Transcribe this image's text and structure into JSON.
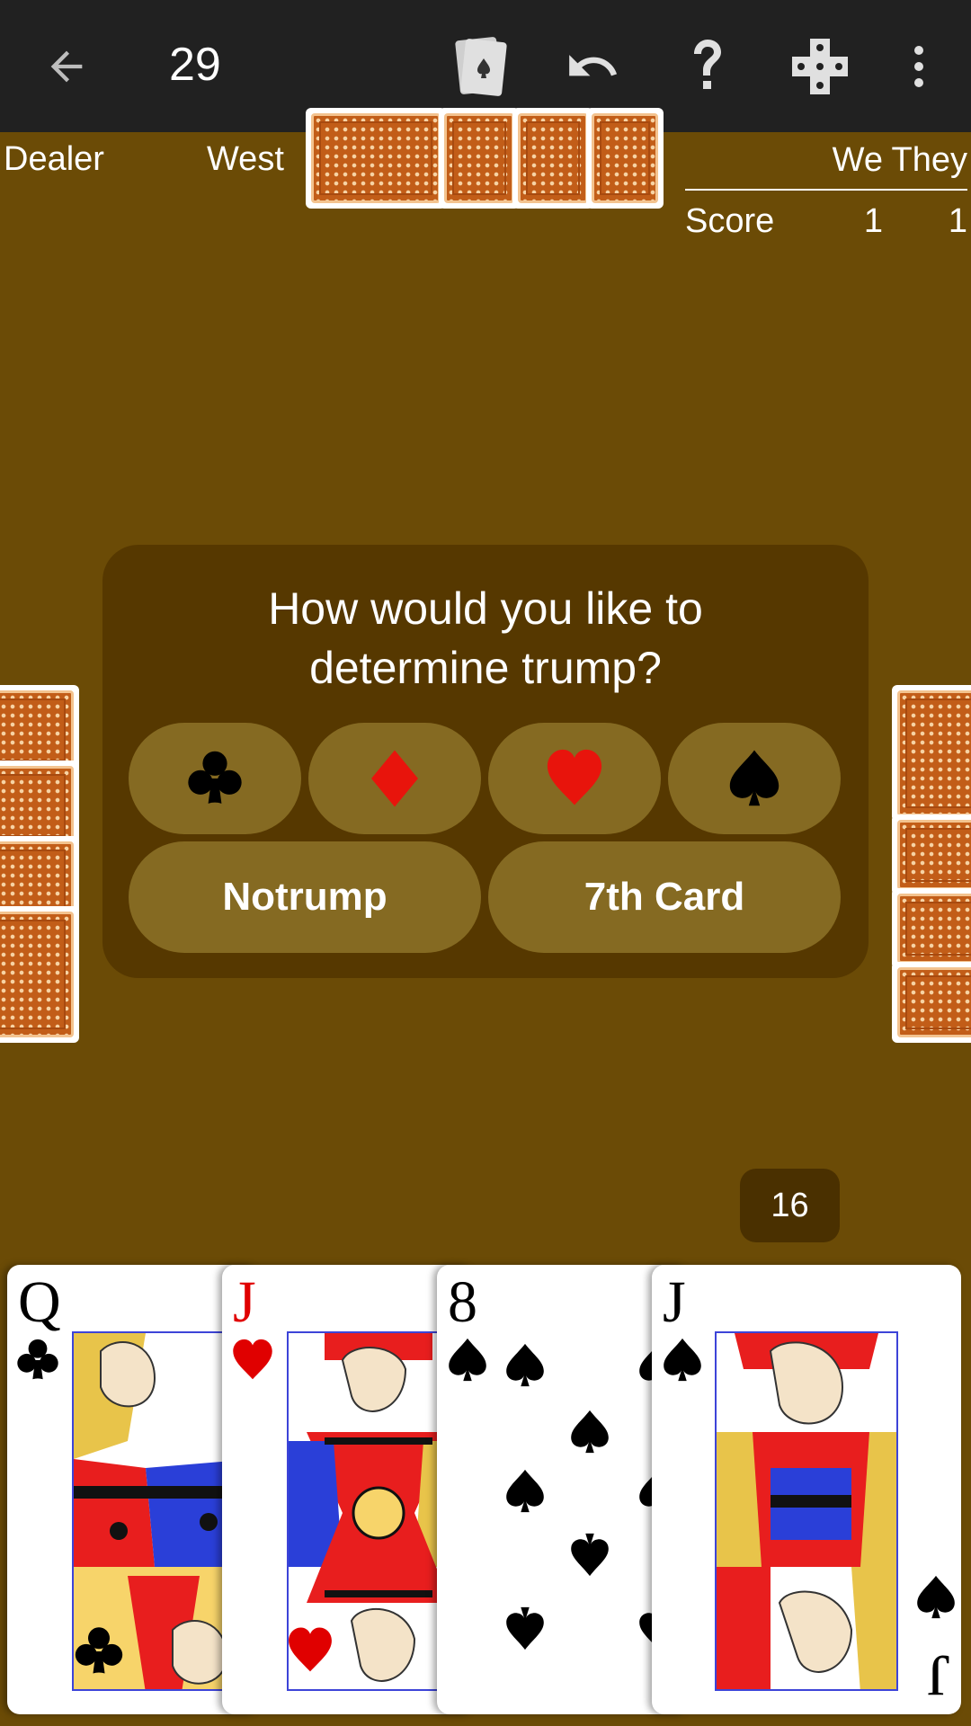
{
  "appbar": {
    "title": "29",
    "icons": [
      "back-arrow-icon",
      "cards-icon",
      "undo-icon",
      "help-icon",
      "dice-icon",
      "more-vert-icon"
    ]
  },
  "table": {
    "dealer_label": "Dealer",
    "west_label": "West"
  },
  "scoreboard": {
    "headers": [
      "",
      "We",
      "They"
    ],
    "rows": [
      {
        "label": "Score",
        "we": "1",
        "they": "1"
      }
    ]
  },
  "dialog": {
    "question": "How would you like to determine trump?",
    "suit_buttons": [
      "club-icon",
      "diamond-icon",
      "heart-icon",
      "spade-icon"
    ],
    "notrump_label": "Notrump",
    "seventh_card_label": "7th Card"
  },
  "bid_counter": "16",
  "hand": [
    {
      "rank": "Q",
      "suit": "clubs",
      "color": "#000000"
    },
    {
      "rank": "J",
      "suit": "hearts",
      "color": "#e00000"
    },
    {
      "rank": "8",
      "suit": "spades",
      "color": "#000000"
    },
    {
      "rank": "J",
      "suit": "spades",
      "color": "#000000"
    }
  ],
  "colors": {
    "felt": "#6b4b06",
    "appbar": "#212121",
    "dialog": "#563800",
    "button": "#856a22",
    "card_back": "#c25d18"
  }
}
